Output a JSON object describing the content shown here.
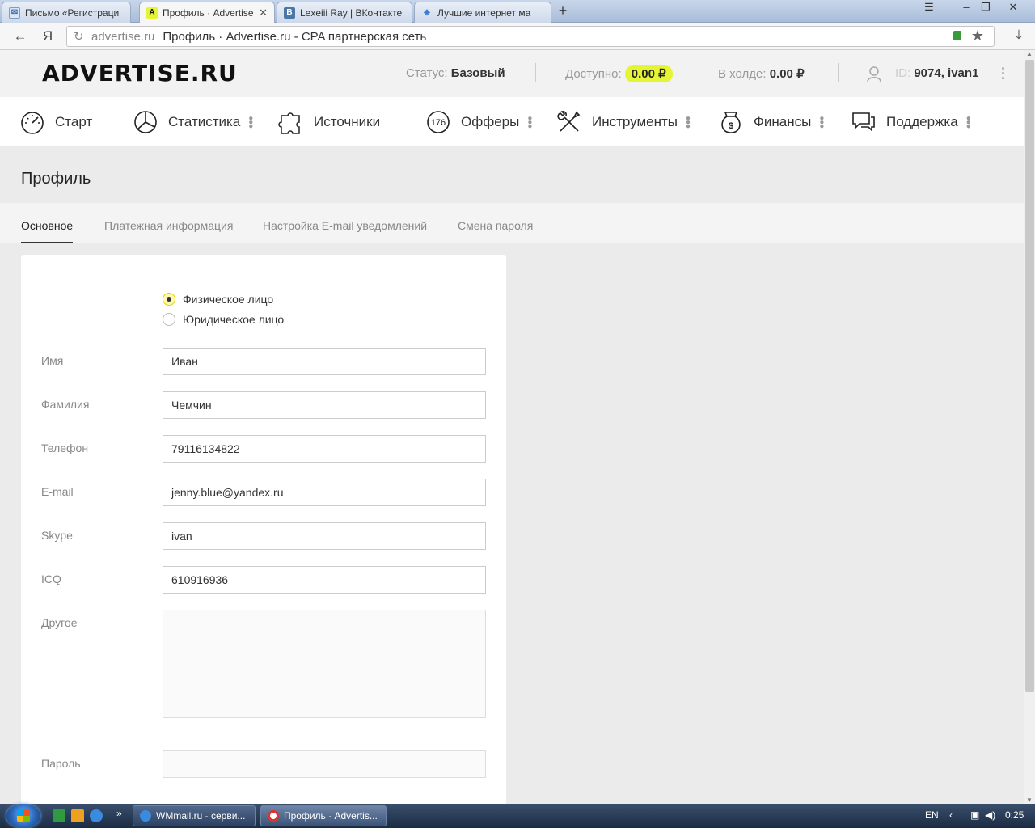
{
  "browser": {
    "tabs": [
      {
        "label": "Письмо «Регистраци"
      },
      {
        "label": "Профиль · Advertise.r"
      },
      {
        "label": "Lexeiii Ray | ВКонтакте"
      },
      {
        "label": "Лучшие интернет ма"
      }
    ],
    "new_tab_label": "+",
    "yandex_btn": "Я",
    "url_domain": "advertise.ru",
    "url_title": "Профиль · Advertise.ru - CPA партнерская сеть"
  },
  "header": {
    "logo": "ADVERTISE.RU",
    "status_label": "Статус:",
    "status_value": "Базовый",
    "available_label": "Доступно:",
    "available_value": "0.00 ₽",
    "hold_label": "В холде:",
    "hold_value": "0.00 ₽",
    "id_label": "ID:",
    "id_value": "9074, ivan1"
  },
  "nav": [
    {
      "label": "Старт",
      "icon": "speedometer-icon"
    },
    {
      "label": "Статистика",
      "icon": "pie-chart-icon"
    },
    {
      "label": "Источники",
      "icon": "puzzle-icon"
    },
    {
      "label": "Офферы",
      "icon": "offers-badge-icon",
      "badge": "176"
    },
    {
      "label": "Инструменты",
      "icon": "tools-icon"
    },
    {
      "label": "Финансы",
      "icon": "money-bag-icon"
    },
    {
      "label": "Поддержка",
      "icon": "chat-bubbles-icon"
    }
  ],
  "page": {
    "title": "Профиль",
    "tabs": [
      "Основное",
      "Платежная информация",
      "Настройка E-mail уведомлений",
      "Смена пароля"
    ]
  },
  "form": {
    "radio_individual": "Физическое лицо",
    "radio_legal": "Юридическое лицо",
    "fields": [
      {
        "label": "Имя",
        "value": "Иван"
      },
      {
        "label": "Фамилия",
        "value": "Чемчин"
      },
      {
        "label": "Телефон",
        "value": "79116134822"
      },
      {
        "label": "E-mail",
        "value": "jenny.blue@yandex.ru"
      },
      {
        "label": "Skype",
        "value": "ivan"
      },
      {
        "label": "ICQ",
        "value": "610916936"
      }
    ],
    "other_label": "Другое",
    "password_label": "Пароль"
  },
  "taskbar": {
    "items": [
      "WMmail.ru - серви...",
      "Профиль · Advertis..."
    ],
    "lang": "EN",
    "time": "0:25"
  }
}
